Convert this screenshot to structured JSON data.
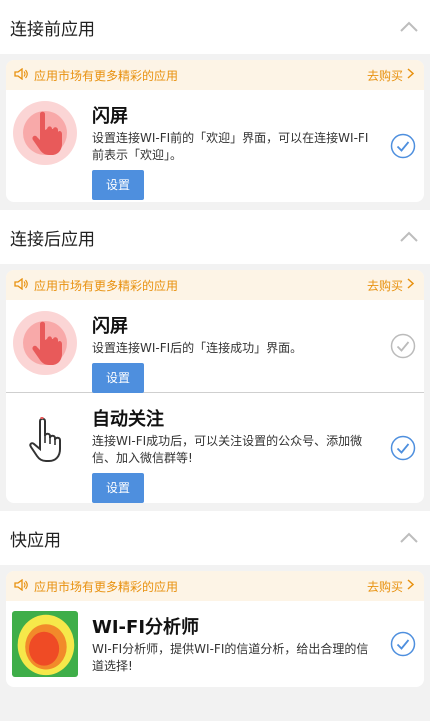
{
  "sections": [
    {
      "title": "连接前应用",
      "banner": {
        "text": "应用市场有更多精彩的应用",
        "action": "去购买"
      },
      "apps": [
        {
          "name": "闪屏",
          "desc": "设置连接WI-FI前的「欢迎」界面，可以在连接WI-FI前表示「欢迎」。",
          "button": "设置",
          "checked": true
        }
      ]
    },
    {
      "title": "连接后应用",
      "banner": {
        "text": "应用市场有更多精彩的应用",
        "action": "去购买"
      },
      "apps": [
        {
          "name": "闪屏",
          "desc": "设置连接WI-FI后的「连接成功」界面。",
          "button": "设置",
          "checked": false
        },
        {
          "name": "自动关注",
          "desc": "连接WI-FI成功后，可以关注设置的公众号、添加微信、加入微信群等!",
          "button": "设置",
          "checked": true
        }
      ]
    },
    {
      "title": "快应用",
      "banner": {
        "text": "应用市场有更多精彩的应用",
        "action": "去购买"
      },
      "apps": [
        {
          "name": "WI-FI分析师",
          "desc": "WI-FI分析师，提供WI-FI的信道分析，给出合理的信道选择!",
          "checked": true
        }
      ]
    }
  ],
  "colors": {
    "accent_blue": "#4e8fde",
    "banner_orange": "#e8910f",
    "banner_bg": "#fdf4e6",
    "check_blue": "#4e8fde",
    "check_gray": "#bbbbbb"
  },
  "icons": {
    "chevron": "chevron-up-icon",
    "speaker": "speaker-icon",
    "arrow": "chevron-right-icon",
    "splash": "hand-tap-icon",
    "follow": "pointer-hand-icon",
    "wifi_analyzer": "wifi-analyzer-icon",
    "check": "check-circle-icon"
  }
}
